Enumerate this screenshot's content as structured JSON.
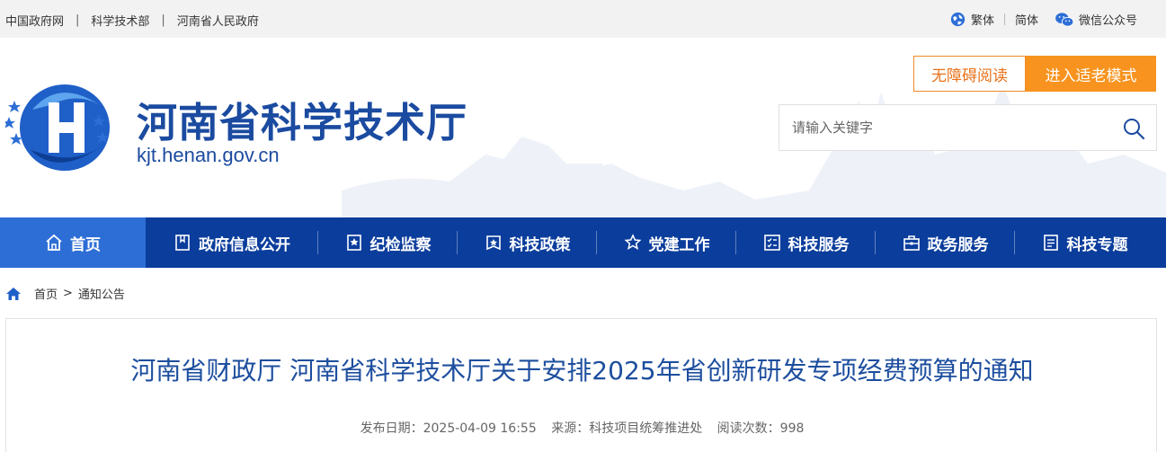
{
  "topbar": {
    "links": [
      "中国政府网",
      "科学技术部",
      "河南省人民政府"
    ],
    "separator": "|",
    "lang_traditional": "繁体",
    "lang_simplified": "简体",
    "wechat": "微信公众号"
  },
  "header": {
    "site_title": "河南省科学技术厅",
    "site_domain": "kjt.henan.gov.cn",
    "accessibility_btn": "无障碍阅读",
    "elder_mode_btn": "进入适老模式",
    "search_placeholder": "请输入关键字"
  },
  "nav": {
    "items": [
      {
        "label": "首页",
        "icon": "home-icon"
      },
      {
        "label": "政府信息公开",
        "icon": "bookmark-icon"
      },
      {
        "label": "纪检监察",
        "icon": "badge-icon"
      },
      {
        "label": "科技政策",
        "icon": "star-box-icon"
      },
      {
        "label": "党建工作",
        "icon": "star-icon"
      },
      {
        "label": "科技服务",
        "icon": "checklist-icon"
      },
      {
        "label": "政务服务",
        "icon": "briefcase-icon"
      },
      {
        "label": "科技专题",
        "icon": "document-icon"
      }
    ],
    "active_index": 0
  },
  "breadcrumb": {
    "home": "首页",
    "separator": ">",
    "current": "通知公告"
  },
  "article": {
    "title": "河南省财政厅 河南省科学技术厅关于安排2025年省创新研发专项经费预算的通知",
    "publish_label": "发布日期：2025-04-09 16:55",
    "source_label": "来源：科技项目统筹推进处",
    "views_label": "阅读次数：998"
  },
  "colors": {
    "brand_blue": "#0b3d9c",
    "nav_active": "#2d6ed6",
    "title_blue": "#1d4e9e",
    "accent_orange": "#f7931e"
  }
}
